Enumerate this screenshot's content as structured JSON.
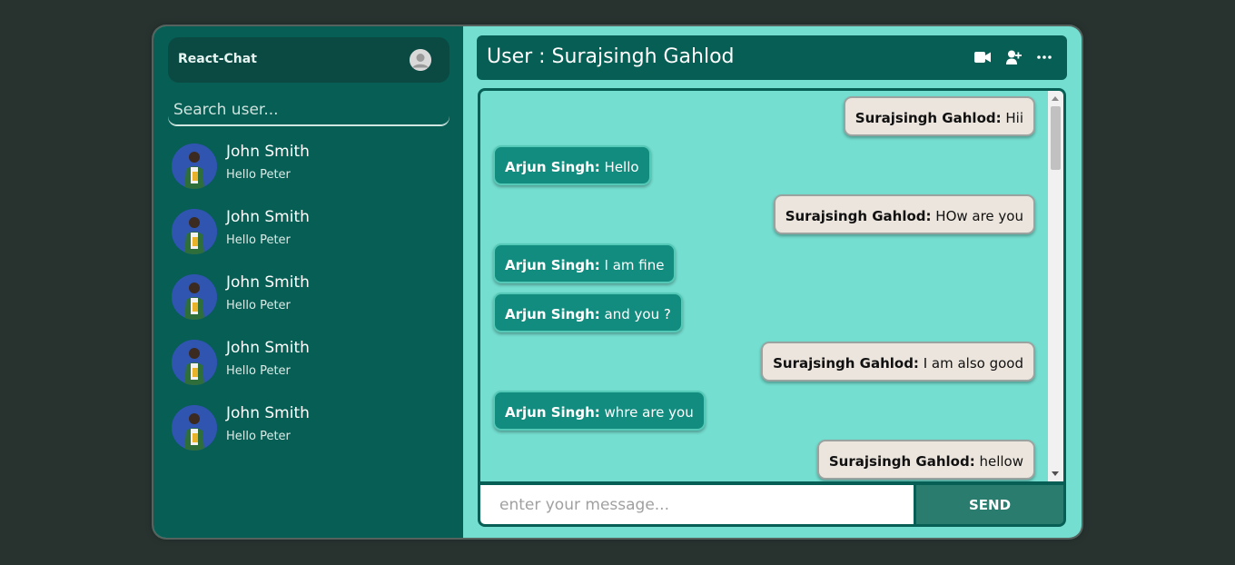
{
  "sidebar": {
    "brand": "React-Chat",
    "search_placeholder": "Search user...",
    "contacts": [
      {
        "name": "John Smith",
        "last_message": "Hello Peter"
      },
      {
        "name": "John Smith",
        "last_message": "Hello Peter"
      },
      {
        "name": "John Smith",
        "last_message": "Hello Peter"
      },
      {
        "name": "John Smith",
        "last_message": "Hello Peter"
      },
      {
        "name": "John Smith",
        "last_message": "Hello Peter"
      }
    ]
  },
  "header": {
    "title": "User : Surajsingh Gahlod",
    "icons": [
      "video-camera-icon",
      "add-user-icon",
      "more-options-icon"
    ]
  },
  "messages": [
    {
      "sender": "Surajsingh Gahlod:",
      "text": " Hii",
      "direction": "out"
    },
    {
      "sender": "Arjun Singh:",
      "text": " Hello",
      "direction": "in"
    },
    {
      "sender": "Surajsingh Gahlod:",
      "text": " HOw are you",
      "direction": "out"
    },
    {
      "sender": "Arjun Singh:",
      "text": " I am fine",
      "direction": "in"
    },
    {
      "sender": "Arjun Singh:",
      "text": " and you ?",
      "direction": "in"
    },
    {
      "sender": "Surajsingh Gahlod:",
      "text": " I am also good",
      "direction": "out"
    },
    {
      "sender": "Arjun Singh:",
      "text": " whre are you",
      "direction": "in"
    },
    {
      "sender": "Surajsingh Gahlod:",
      "text": " hellow",
      "direction": "out"
    }
  ],
  "composer": {
    "placeholder": "enter your message...",
    "send_label": "SEND"
  },
  "colors": {
    "sidebar_bg": "#075e54",
    "chat_bg": "#74ded0",
    "incoming_bubble": "#128c7e",
    "outgoing_bubble": "#ece5dd",
    "send_button": "#2a7c6e"
  }
}
